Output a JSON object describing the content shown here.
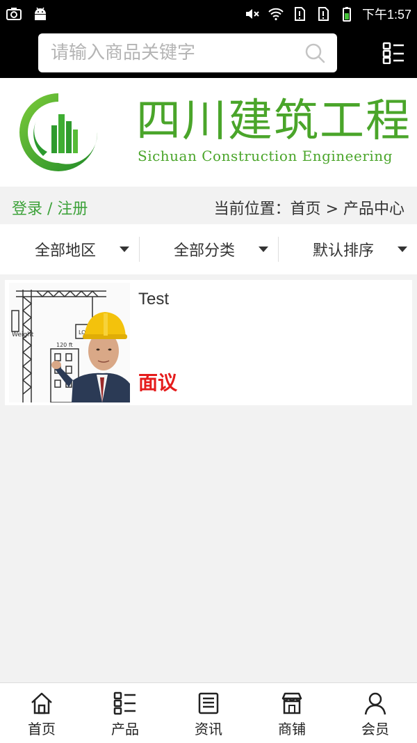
{
  "status_bar": {
    "time": "下午1:57",
    "icons": [
      "camera-icon",
      "android-icon",
      "mute-icon",
      "wifi-icon",
      "sim1-icon",
      "sim2-icon",
      "battery-icon"
    ]
  },
  "search": {
    "placeholder": "请输入商品关键字",
    "value": ""
  },
  "banner": {
    "brand_cn": "四川建筑工程",
    "brand_en": "Sichuan Construction Engineering",
    "brand_color": "#4aa52a"
  },
  "location": {
    "login": "登录",
    "separator": " / ",
    "register": "注册",
    "breadcrumb": "当前位置：首页 > 产品中心"
  },
  "filters": [
    {
      "label": "全部地区"
    },
    {
      "label": "全部分类"
    },
    {
      "label": "默认排序"
    }
  ],
  "products": [
    {
      "title": "Test",
      "price": "面议",
      "image": "construction-engineer-photo"
    }
  ],
  "bottom_nav": [
    {
      "label": "首页",
      "icon": "home-icon"
    },
    {
      "label": "产品",
      "icon": "list-icon"
    },
    {
      "label": "资讯",
      "icon": "news-icon"
    },
    {
      "label": "商铺",
      "icon": "store-icon"
    },
    {
      "label": "会员",
      "icon": "member-icon"
    }
  ],
  "colors": {
    "accent_green": "#3da23a",
    "price_red": "#e51c1c",
    "header_bg": "#000000"
  }
}
